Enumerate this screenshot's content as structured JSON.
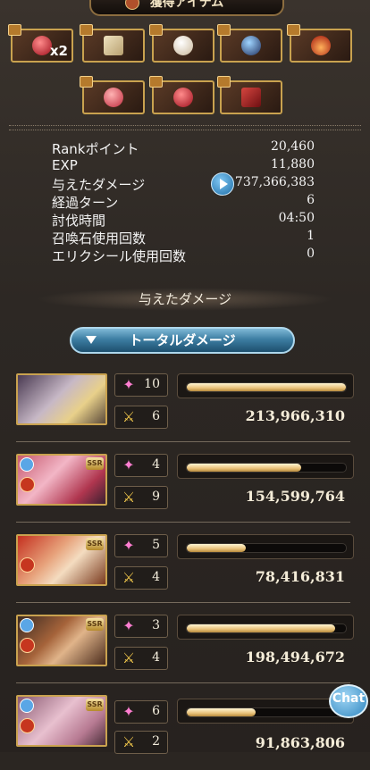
{
  "header": {
    "title": "獲得アイテム"
  },
  "items": {
    "row1": [
      {
        "icon": "red-gem-icon",
        "count": "x2"
      },
      {
        "icon": "scroll-icon",
        "count": ""
      },
      {
        "icon": "crystal-ball-icon",
        "count": ""
      },
      {
        "icon": "dark-orb-icon",
        "count": ""
      },
      {
        "icon": "flame-icon",
        "count": ""
      }
    ],
    "row2": [
      {
        "icon": "red-orb-icon",
        "count": ""
      },
      {
        "icon": "red-gem-icon",
        "count": ""
      },
      {
        "icon": "red-tome-icon",
        "count": ""
      }
    ]
  },
  "stats": [
    {
      "label": "Rankポイント",
      "value": "20,460"
    },
    {
      "label": "EXP",
      "value": "11,880"
    },
    {
      "label": "与えたダメージ",
      "value": "737,366,383"
    },
    {
      "label": "経過ターン",
      "value": "6"
    },
    {
      "label": "討伐時間",
      "value": "04:50"
    },
    {
      "label": "召喚石使用回数",
      "value": "1"
    },
    {
      "label": "エリクシール使用回数",
      "value": "0"
    }
  ],
  "damage_section": {
    "title": "与えたダメージ",
    "dropdown_label": "トータルダメージ"
  },
  "characters": [
    {
      "name": "main-character",
      "ssr": false,
      "element_badge": false,
      "skill_count": "10",
      "ougi_count": "6",
      "bar_fraction": 1.0,
      "damage": "213,966,310"
    },
    {
      "name": "character-2",
      "ssr": true,
      "element_badge": true,
      "skill_count": "4",
      "ougi_count": "9",
      "bar_fraction": 0.72,
      "damage": "154,599,764"
    },
    {
      "name": "character-3",
      "ssr": true,
      "element_badge": false,
      "skill_count": "5",
      "ougi_count": "4",
      "bar_fraction": 0.37,
      "damage": "78,416,831"
    },
    {
      "name": "character-4",
      "ssr": true,
      "element_badge": true,
      "skill_count": "3",
      "ougi_count": "4",
      "bar_fraction": 0.93,
      "damage": "198,494,672"
    },
    {
      "name": "character-5",
      "ssr": true,
      "element_badge": true,
      "skill_count": "6",
      "ougi_count": "2",
      "bar_fraction": 0.43,
      "damage": "91,863,806"
    }
  ],
  "chat": {
    "label": "Chat"
  },
  "colors": {
    "bar_fill": "#e9c27a",
    "button_blue": "#3d7ea3",
    "frame_gold": "#c9a24f"
  }
}
